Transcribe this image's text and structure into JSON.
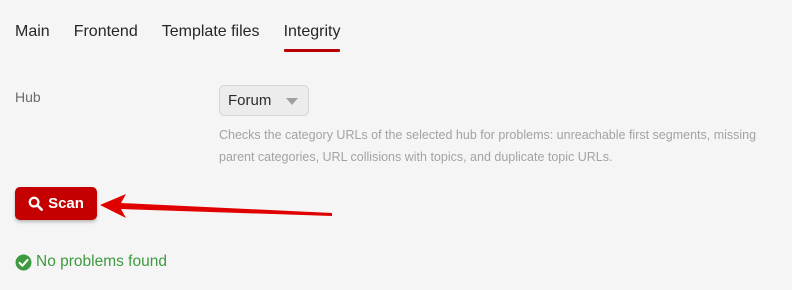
{
  "tabs": [
    {
      "label": "Main",
      "active": false
    },
    {
      "label": "Frontend",
      "active": false
    },
    {
      "label": "Template files",
      "active": false
    },
    {
      "label": "Integrity",
      "active": true
    }
  ],
  "form": {
    "hub_label": "Hub",
    "hub_select_value": "Forum",
    "hub_help": "Checks the category URLs of the selected hub for problems: unreachable first segments, missing parent categories, URL collisions with topics, and duplicate topic URLs."
  },
  "actions": {
    "scan_label": "Scan",
    "scan_icon": "search-icon"
  },
  "status": {
    "text": "No problems found",
    "icon": "check-circle-icon",
    "color": "#3e9a3e"
  },
  "annotation": {
    "arrow_color": "#e00000"
  },
  "colors": {
    "accent": "#c40000",
    "background": "#f5f5f5"
  }
}
